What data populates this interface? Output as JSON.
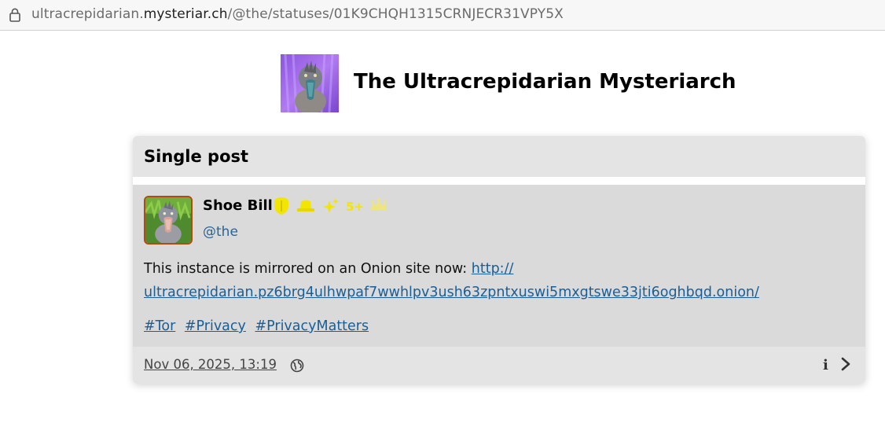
{
  "browser": {
    "url_subdomain": "ultracrepidarian.",
    "url_domain": "mysteriar.ch",
    "url_path": "/@the/statuses/01K9CHQH1315CRNJECR31VPY5X"
  },
  "site": {
    "title": "The Ultracrepidarian Mysteriarch"
  },
  "card": {
    "heading": "Single post"
  },
  "post": {
    "author_name": "Shoe Bill",
    "handle": "@the",
    "text": "This instance is mirrored on an Onion site now: ",
    "link_line1": "http://",
    "link_line2": "ultracrepidarian.pz6brg4ulhwpaf7wwhlpv3ush63zpntxuswi5mxgtswe33jti6oghbqd.onion/",
    "hashtags": [
      "#Tor",
      "#Privacy",
      "#PrivacyMatters"
    ],
    "timestamp": "Nov 06, 2025, 13:19",
    "badge_icons": [
      "shield-badge-icon",
      "hat-badge-icon",
      "sparkle-badge-icon",
      "five-plus-badge-icon",
      "crown-badge-icon"
    ]
  },
  "colors": {
    "link": "#1a5e97",
    "handle": "#2a6395",
    "badge_yellow": "#f2e600",
    "avatar_border": "#b34b10"
  }
}
